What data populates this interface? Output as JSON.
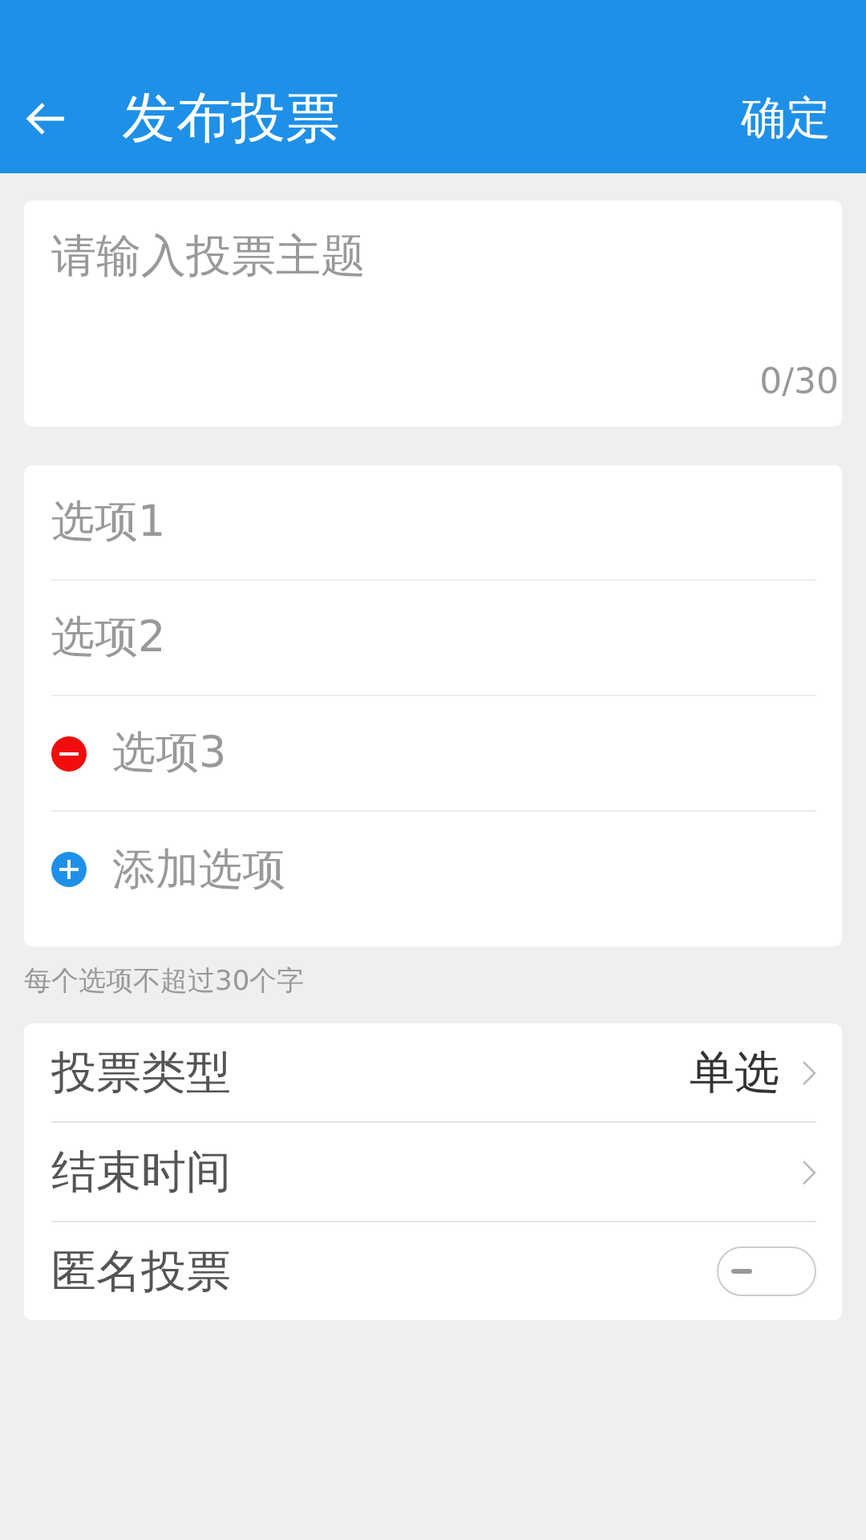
{
  "header": {
    "title": "发布投票",
    "confirm": "确定"
  },
  "topic": {
    "placeholder": "请输入投票主题",
    "counter": "0/30"
  },
  "options": [
    {
      "kind": "input",
      "placeholder": "选项1"
    },
    {
      "kind": "input",
      "placeholder": "选项2"
    },
    {
      "kind": "removable",
      "placeholder": "选项3"
    },
    {
      "kind": "add",
      "label": "添加选项"
    }
  ],
  "hint": "每个选项不超过30个字",
  "settings": [
    {
      "kind": "select",
      "label": "投票类型",
      "value": "单选"
    },
    {
      "kind": "picker",
      "label": "结束时间"
    },
    {
      "kind": "toggle",
      "label": "匿名投票",
      "on": false
    }
  ]
}
